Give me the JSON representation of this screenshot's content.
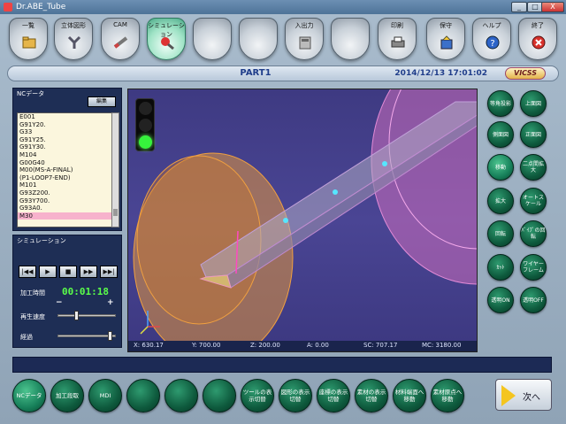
{
  "window": {
    "title": "Dr.ABE_Tube",
    "min": "_",
    "max": "□",
    "close": "X"
  },
  "toolbar": [
    {
      "label": "一覧",
      "icon": "folder-icon"
    },
    {
      "label": "立体図形",
      "icon": "tube-shape-icon"
    },
    {
      "label": "CAM",
      "icon": "cam-icon"
    },
    {
      "label": "シミュレーション",
      "icon": "simulation-icon",
      "active": true
    },
    {
      "label": "",
      "icon": "blank-icon"
    },
    {
      "label": "",
      "icon": "blank-icon"
    },
    {
      "label": "入出力",
      "icon": "io-icon"
    },
    {
      "label": "",
      "icon": "blank-icon"
    },
    {
      "label": "印刷",
      "icon": "printer-icon"
    },
    {
      "label": "保守",
      "icon": "maintenance-icon"
    },
    {
      "label": "ヘルプ",
      "icon": "help-icon"
    },
    {
      "label": "終了",
      "icon": "exit-icon"
    }
  ],
  "header": {
    "title": "PART1",
    "datetime": "2014/12/13 17:01:02",
    "logo": "VICSS"
  },
  "nc": {
    "title": "NCデータ",
    "edit_label": "編集",
    "lines": [
      "E001",
      "G91Y20.",
      "G33",
      "G91Y25.",
      "G91Y30.",
      "M104",
      "G00G40",
      "M00(MS-A-FINAL)",
      "(P1-LOOP7-END)",
      "M101",
      "G93Z200.",
      "G93Y700.",
      "G93A0.",
      "M30"
    ],
    "selected_index": 13
  },
  "sim": {
    "title": "シミュレーション",
    "buttons": [
      "|◀◀",
      "▶",
      "■",
      "▶▶",
      "▶▶|"
    ],
    "time_label": "加工時間",
    "time_value": "00:01:18",
    "minus": "−",
    "plus": "+",
    "speed_label": "再生速度",
    "speed_fraction": 0.3,
    "progress_label": "経過",
    "progress_fraction": 0.93
  },
  "coords": {
    "x": "X: 630.17",
    "y": "Y: 700.00",
    "z": "Z: 200.00",
    "a": "A: 0.00",
    "sc": "SC: 707.17",
    "mc": "MC: 3180.00"
  },
  "right_buttons": [
    [
      "等角投影",
      "上面図"
    ],
    [
      "側面図",
      "正面図"
    ],
    [
      "移動",
      "二点間拡大"
    ],
    [
      "拡大",
      "オートスケール"
    ],
    [
      "回転",
      "ﾊﾞｲﾌﾟの回転"
    ],
    [
      "ｶｯﾄ",
      "ワイヤーフレーム"
    ],
    [
      "透明ON",
      "透明OFF"
    ]
  ],
  "bottom_buttons": [
    "NCデータ",
    "加工段取",
    "MDI",
    "",
    "",
    "",
    "ツールの表示切替",
    "図形の表示切替",
    "座標の表示切替",
    "素材の表示切替",
    "材料端面へ移動",
    "素材原点へ移動"
  ],
  "next_label": "次へ",
  "colors": {
    "accent_green": "#0e5a3d",
    "viewport_bg": "#3e3a82",
    "selected_line": "#f7b2cc",
    "timer": "#5bff4a"
  }
}
